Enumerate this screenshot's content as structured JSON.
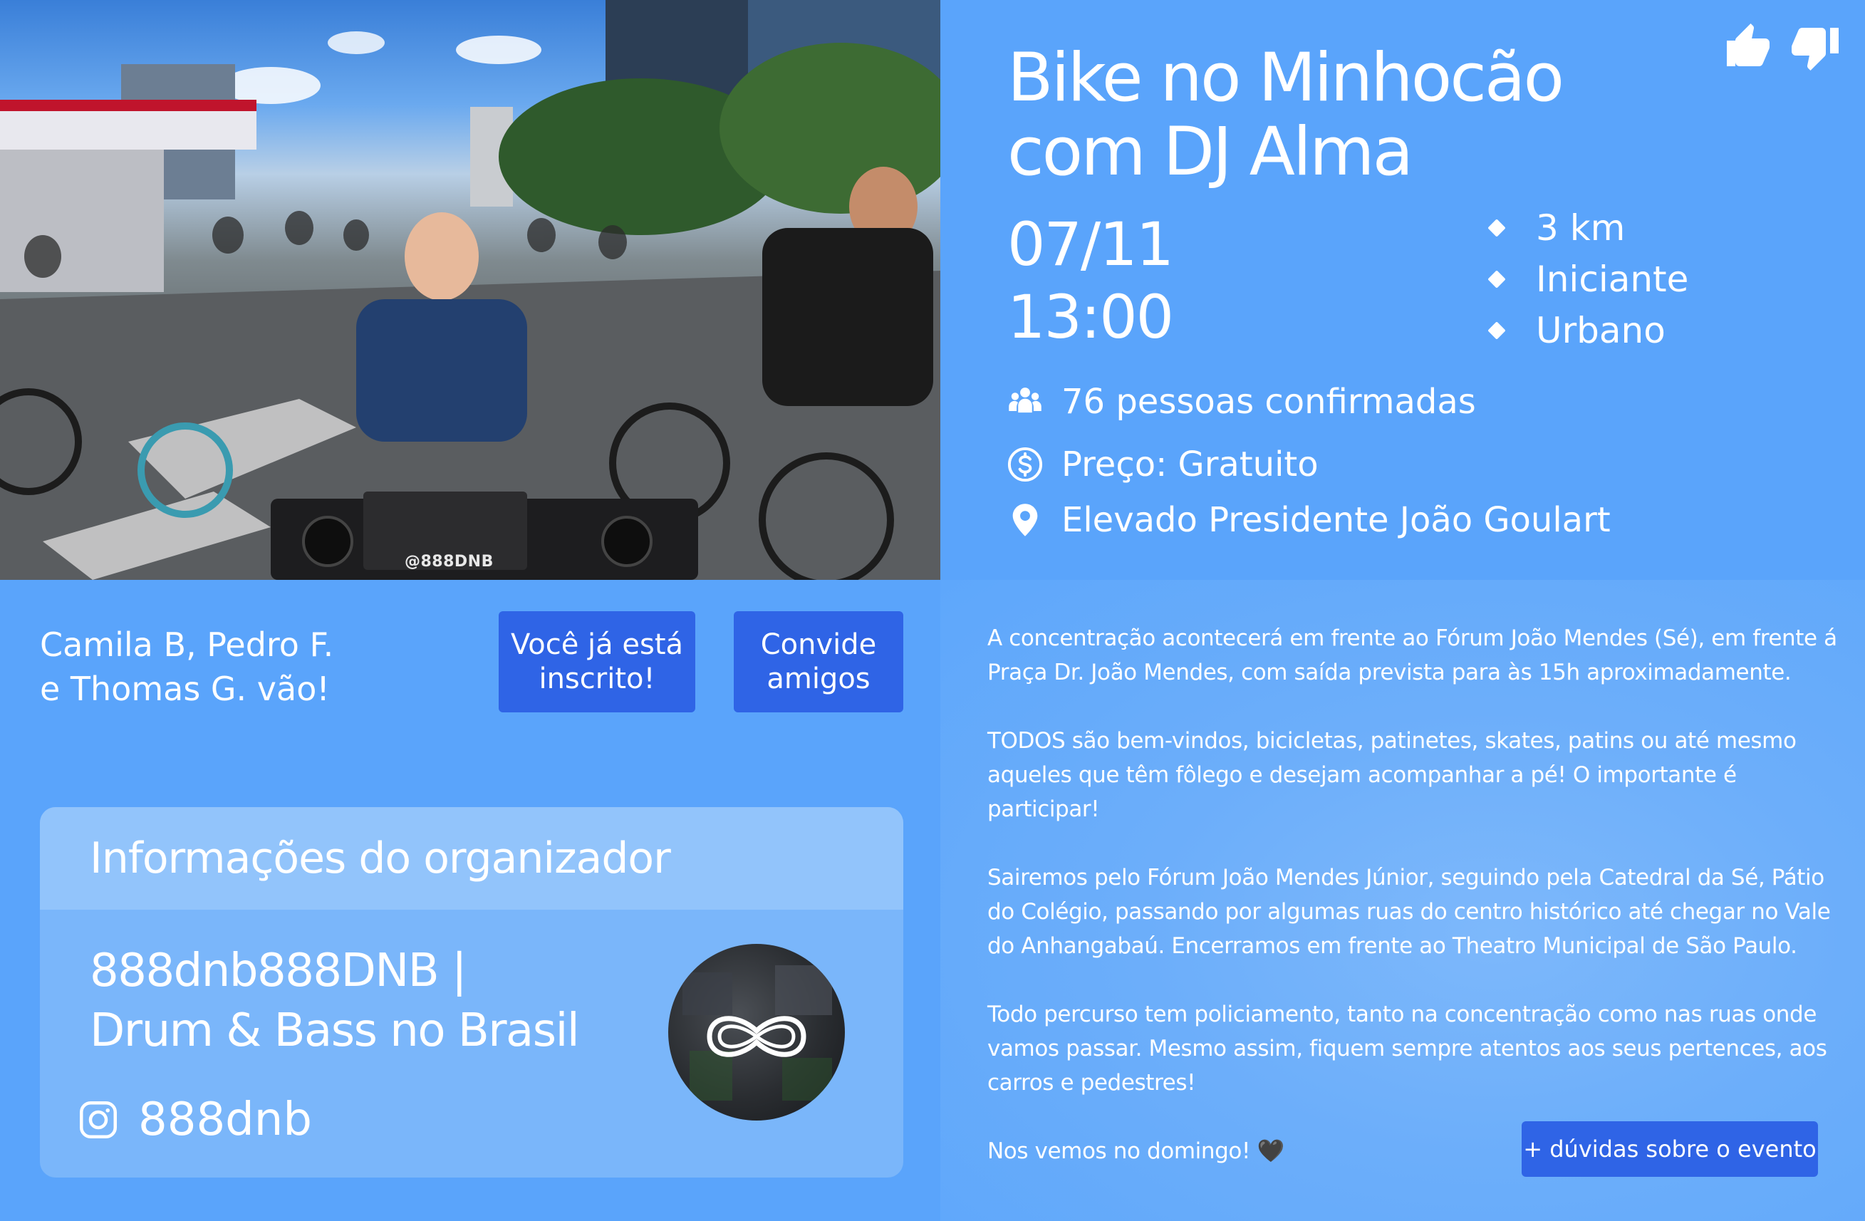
{
  "event": {
    "title_line1": "Bike no Minhocão",
    "title_line2": "com DJ Alma",
    "date": "07/11",
    "time": "13:00",
    "attributes": [
      "3 km",
      "Iniciante",
      "Urbano"
    ],
    "confirmed": "76 pessoas confirmadas",
    "price": "Preço: Gratuito",
    "location": "Elevado Presidente João Goulart",
    "photo_watermark": "@888DNB"
  },
  "icons": {
    "like": "thumbs-up-icon",
    "dislike": "thumbs-down-icon",
    "people": "people-icon",
    "price": "dollar-circle-icon",
    "location": "map-pin-icon",
    "instagram": "instagram-icon"
  },
  "social": {
    "friends_line1": "Camila B, Pedro F.",
    "friends_line2": "e Thomas G. vão!",
    "enrolled_line1": "Você já está",
    "enrolled_line2": "inscrito!",
    "invite_line1": "Convide",
    "invite_line2": "amigos"
  },
  "organizer": {
    "heading": "Informações do organizador",
    "name_line1": "888dnb888DNB |",
    "name_line2": "Drum & Bass no Brasil",
    "instagram": "888dnb"
  },
  "description": {
    "paragraphs": [
      "A concentração acontecerá em frente ao Fórum João Mendes (Sé), em frente á Praça Dr. João Mendes, com saída prevista para às 15h aproximadamente.",
      "TODOS são bem-vindos, bicicletas, patinetes, skates, patins ou até mesmo aqueles que têm fôlego e desejam acompanhar a pé! O importante é participar!",
      "Sairemos pelo Fórum João Mendes Júnior, seguindo pela Catedral da Sé, Pátio do Colégio, passando por algumas ruas do centro histórico até chegar no Vale do Anhangabaú. Encerramos em frente ao Theatro Municipal de São Paulo.",
      "Todo percurso tem policiamento, tanto na concentração como nas ruas onde vamos passar. Mesmo assim, fiquem sempre atentos aos seus pertences, aos carros e pedestres!",
      "Nos vemos no domingo! 🖤"
    ],
    "doubts_button": "+ dúvidas sobre o evento"
  },
  "colors": {
    "panel": "#5aa4fb",
    "button": "#2f64e6",
    "card": "#7ab6fa",
    "card_header": "#92c4fb"
  }
}
